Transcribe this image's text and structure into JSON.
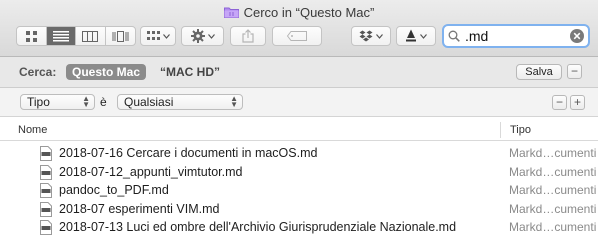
{
  "window": {
    "title": "Cerco in “Questo Mac”"
  },
  "toolbar": {
    "view_modes": [
      "icon-view",
      "list-view",
      "column-view",
      "cover-flow-view"
    ],
    "active_view": 1,
    "search": {
      "query": ".md"
    }
  },
  "scope": {
    "label": "Cerca:",
    "this_mac": "Questo Mac",
    "disk": "“MAC HD”",
    "save": "Salva",
    "minus": "−"
  },
  "criteria": {
    "attribute": "Tipo",
    "verb": "è",
    "value": "Qualsiasi",
    "minus": "−",
    "plus": "+"
  },
  "columns": {
    "name": "Nome",
    "kind": "Tipo"
  },
  "files": [
    {
      "name": "2018-07-16 Cercare i documenti in macOS.md",
      "kind": "Markd…cumenti"
    },
    {
      "name": "2018-07-12_appunti_vimtutor.md",
      "kind": "Markd…cumenti"
    },
    {
      "name": "pandoc_to_PDF.md",
      "kind": "Markd…cumenti"
    },
    {
      "name": "2018-07 esperimenti VIM.md",
      "kind": "Markd…cumenti"
    },
    {
      "name": "2018-07-13 Luci ed ombre dell'Archivio Giurisprudenziale Nazionale.md",
      "kind": "Markd…cumenti"
    }
  ]
}
